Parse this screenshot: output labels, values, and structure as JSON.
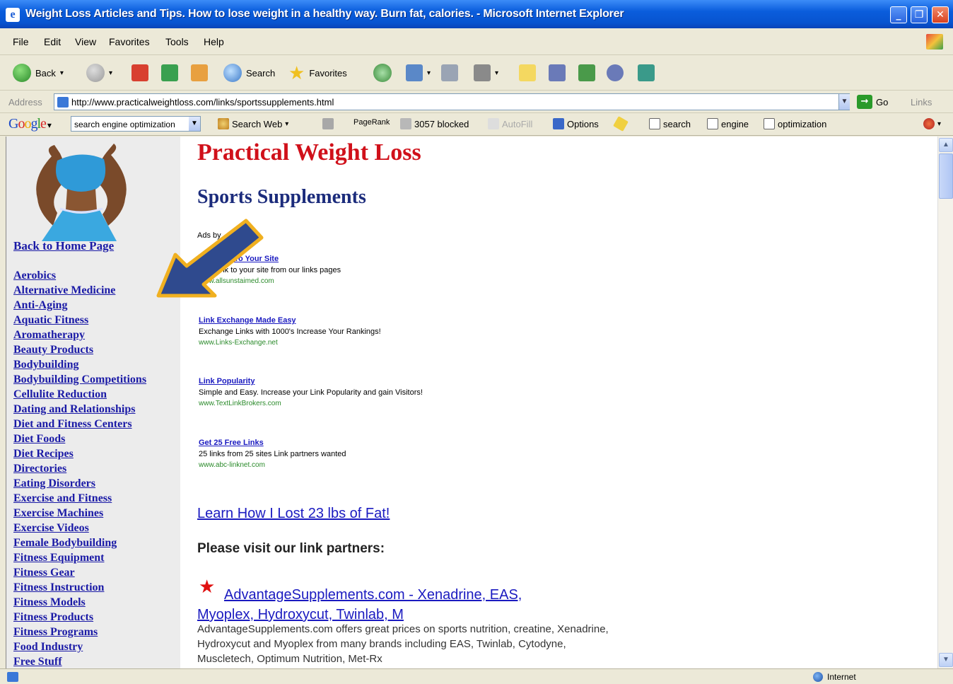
{
  "window": {
    "title": "Weight Loss Articles and Tips. How to lose weight in a healthy way. Burn fat, calories. - Microsoft Internet Explorer",
    "minimize": "_",
    "maximize": "❐",
    "close": "✕"
  },
  "menu": [
    "File",
    "Edit",
    "View",
    "Favorites",
    "Tools",
    "Help"
  ],
  "toolbar": {
    "back": "Back",
    "search": "Search",
    "favorites": "Favorites"
  },
  "address": {
    "label": "Address",
    "url": "http://www.practicalweightloss.com/links/sportssupplements.html",
    "go": "Go",
    "links": "Links"
  },
  "googlebar": {
    "logo": "Google",
    "query": "search engine optimization",
    "search_web": "Search Web",
    "pagerank": "PageRank",
    "blocked": "3057 blocked",
    "autofill": "AutoFill",
    "options": "Options",
    "words": [
      "search",
      "engine",
      "optimization"
    ]
  },
  "sidebar": {
    "back_home": "Back to Home Page",
    "categories": [
      "Aerobics",
      "Alternative Medicine",
      "Anti-Aging",
      "Aquatic Fitness",
      "Aromatherapy",
      "Beauty Products",
      "Bodybuilding",
      "Bodybuilding Competitions",
      "Cellulite Reduction",
      "Dating and Relationships",
      "Diet and Fitness Centers",
      "Diet Foods",
      "Diet Recipes",
      "Directories",
      "Eating Disorders",
      "Exercise and Fitness",
      "Exercise Machines",
      "Exercise Videos",
      "Female Bodybuilding",
      "Fitness Equipment",
      "Fitness Gear",
      "Fitness Instruction",
      "Fitness Models",
      "Fitness Products",
      "Fitness Programs",
      "Food Industry",
      "Free Stuff"
    ]
  },
  "main": {
    "site_title": "Practical Weight Loss",
    "heading": "Sports Supplements",
    "ads_label": "Ads by",
    "ads": [
      {
        "title": "Add Link To Your Site",
        "desc": "Free link to your site from our links pages",
        "url": "www.allsunstaimed.com"
      },
      {
        "title": "Link Exchange Made Easy",
        "desc": "Exchange Links with 1000's Increase Your Rankings!",
        "url": "www.Links-Exchange.net"
      },
      {
        "title": "Link Popularity",
        "desc": "Simple and Easy. Increase your Link Popularity and gain Visitors!",
        "url": "www.TextLinkBrokers.com"
      },
      {
        "title": "Get 25 Free Links",
        "desc": "25 links from 25 sites Link partners wanted",
        "url": "www.abc-linknet.com"
      }
    ],
    "learn_link": "Learn How I Lost 23 lbs of Fat!",
    "partners_heading": "Please visit our link partners:",
    "partner": {
      "title": "AdvantageSupplements.com - Xenadrine, EAS, Myoplex, Hydroxycut, Twinlab, M",
      "desc": "AdvantageSupplements.com offers great prices on sports nutrition, creatine, Xenadrine, Hydroxycut and Myoplex from many brands including EAS, Twinlab, Cytodyne, Muscletech, Optimum Nutrition, Met-Rx"
    }
  },
  "status": {
    "zone": "Internet"
  },
  "colors": {
    "site_title": "#d0101a",
    "heading": "#1c2c7c",
    "link": "#1a1ac0",
    "arrow_fill": "#2f4a8e",
    "arrow_outline": "#f0b020"
  }
}
